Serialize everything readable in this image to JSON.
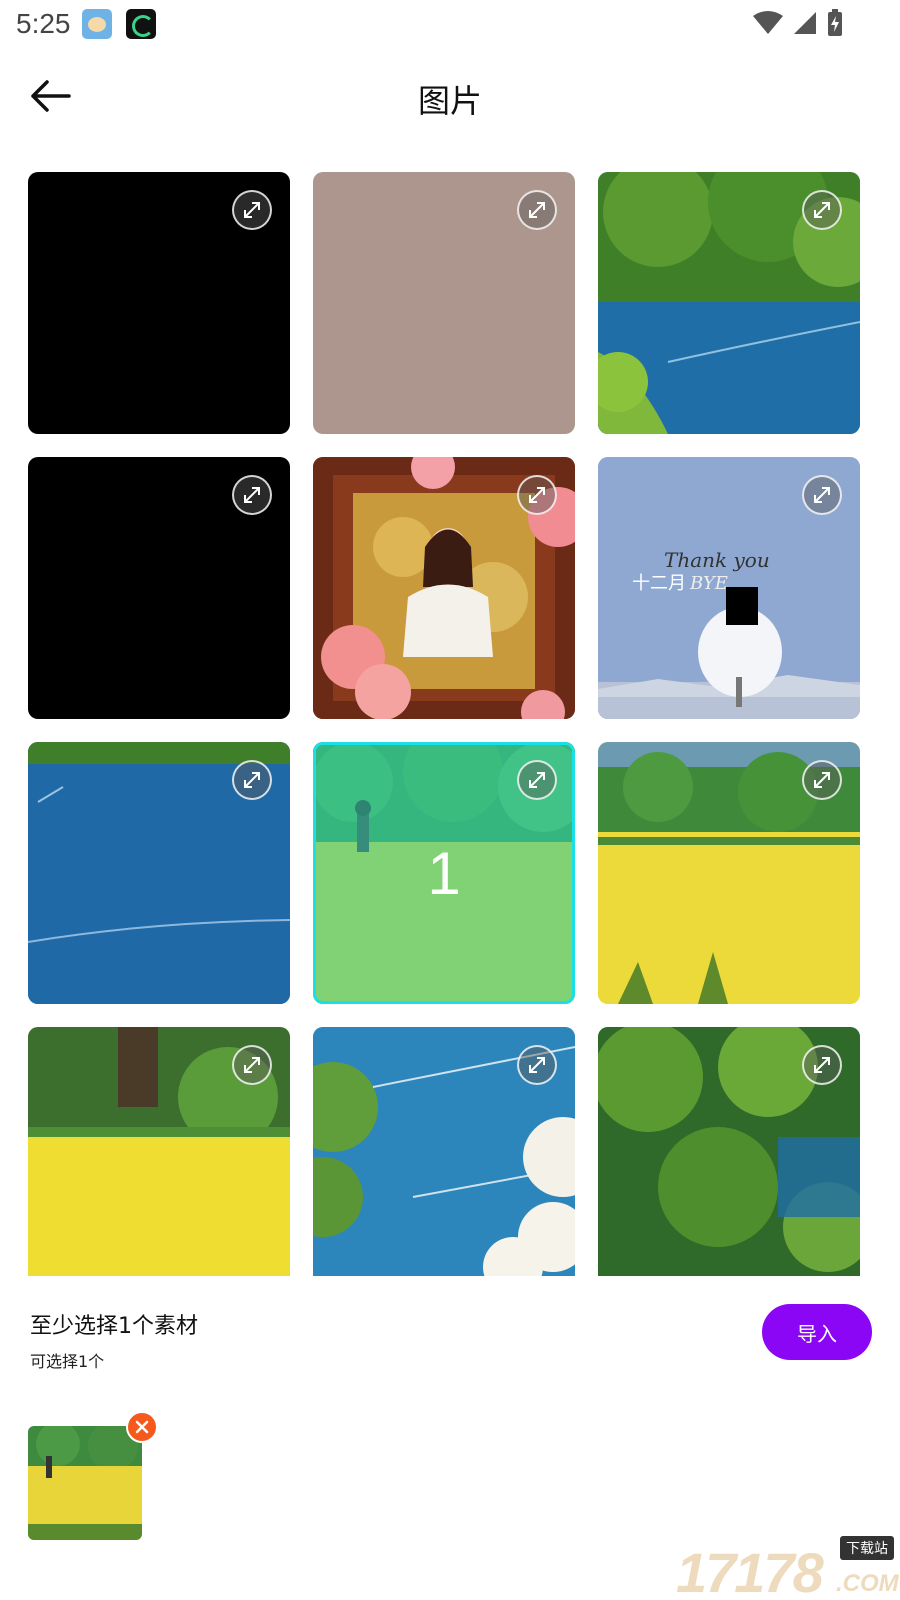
{
  "status_bar": {
    "time": "5:25",
    "notification_icons": [
      "avatar-app-icon",
      "moon-app-icon"
    ],
    "system_icons": [
      "wifi-icon",
      "signal-icon",
      "battery-charging-icon"
    ]
  },
  "header": {
    "back_icon": "back-arrow-icon",
    "title": "图片"
  },
  "grid": {
    "items": [
      {
        "id": 1,
        "kind": "black",
        "expand_icon": "expand-icon"
      },
      {
        "id": 2,
        "kind": "taupe",
        "color": "#ad968d",
        "expand_icon": "expand-icon"
      },
      {
        "id": 3,
        "kind": "trees-over-water",
        "expand_icon": "expand-icon"
      },
      {
        "id": 4,
        "kind": "black",
        "expand_icon": "expand-icon"
      },
      {
        "id": 5,
        "kind": "framed-portrait-roses",
        "expand_icon": "expand-icon"
      },
      {
        "id": 6,
        "kind": "snowy-tree-sky",
        "overlay_text": [
          "Thank you",
          "十二月",
          "BYE"
        ],
        "expand_icon": "expand-icon"
      },
      {
        "id": 7,
        "kind": "blue-sky",
        "expand_icon": "expand-icon"
      },
      {
        "id": 8,
        "kind": "field-girl",
        "selected": true,
        "selection_number": "1",
        "expand_icon": "expand-icon"
      },
      {
        "id": 9,
        "kind": "yellow-field",
        "expand_icon": "expand-icon"
      },
      {
        "id": 10,
        "kind": "tree-yellow-field",
        "expand_icon": "expand-icon"
      },
      {
        "id": 11,
        "kind": "sky-clouds",
        "expand_icon": "expand-icon"
      },
      {
        "id": 12,
        "kind": "leafy-trees",
        "expand_icon": "expand-icon"
      }
    ]
  },
  "bottom": {
    "hint_main": "至少选择1个素材",
    "hint_sub": "可选择1个",
    "import_label": "导入",
    "remove_icon": "close-icon"
  },
  "colors": {
    "accent": "#8a06f5",
    "selection_border": "#19e0e6",
    "remove_badge": "#f5591c"
  },
  "watermark": {
    "number": "17178",
    "tag": "下载站",
    "domain": ".COM"
  }
}
